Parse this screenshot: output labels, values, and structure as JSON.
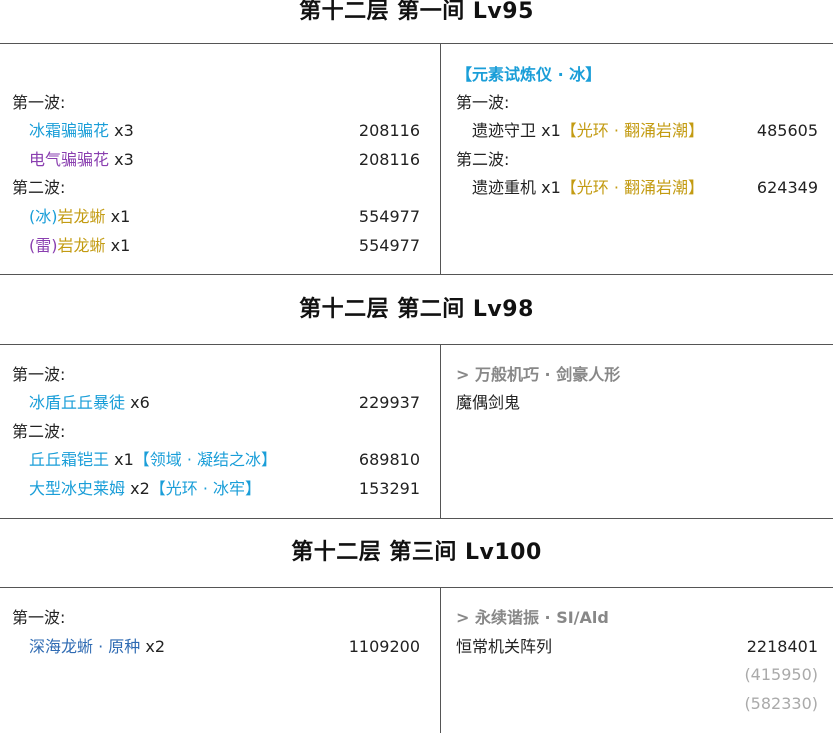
{
  "colors": {
    "ice": "#1a9ed8",
    "electro": "#8a3fb0",
    "geo": "#c39b12",
    "hydro": "#2f6bb3",
    "muted": "#888888",
    "line": "#555555"
  },
  "chambers": [
    {
      "title": "第十二层  第一间 Lv95",
      "left": {
        "wave1_label": "第一波:",
        "wave1": [
          {
            "name": "冰霜骗骗花",
            "count": "x3",
            "hp": "208116"
          },
          {
            "name": "电气骗骗花",
            "count": "x3",
            "hp": "208116"
          }
        ],
        "wave2_label": "第二波:",
        "wave2": [
          {
            "prefix": "(冰)",
            "name": "岩龙蜥",
            "count": "x1",
            "hp": "554977"
          },
          {
            "prefix": "(雷)",
            "name": "岩龙蜥",
            "count": "x1",
            "hp": "554977"
          }
        ]
      },
      "right": {
        "header": "【元素试炼仪 · 冰】",
        "wave1_label": "第一波:",
        "wave1": [
          {
            "name": "遗迹守卫",
            "count": "x1",
            "tag": "【光环 · 翻涌岩潮】",
            "hp": "485605"
          }
        ],
        "wave2_label": "第二波:",
        "wave2": [
          {
            "name": "遗迹重机",
            "count": "x1",
            "tag": "【光环 · 翻涌岩潮】",
            "hp": "624349"
          }
        ]
      }
    },
    {
      "title": "第十二层  第二间 Lv98",
      "left": {
        "wave1_label": "第一波:",
        "wave1": [
          {
            "name": "冰盾丘丘暴徒",
            "count": "x6",
            "hp": "229937"
          }
        ],
        "wave2_label": "第二波:",
        "wave2": [
          {
            "name": "丘丘霜铠王",
            "count": "x1",
            "tag": "【领域 · 凝结之冰】",
            "hp": "689810"
          },
          {
            "name": "大型冰史莱姆",
            "count": "x2",
            "tag": "【光环 · 冰牢】",
            "hp": "153291"
          }
        ]
      },
      "right": {
        "header": ">  万般机巧 · 剑豪人形",
        "enemy": "魔偶剑鬼"
      }
    },
    {
      "title": "第十二层  第三间 Lv100",
      "left": {
        "wave1_label": "第一波:",
        "wave1": [
          {
            "name": "深海龙蜥 · 原种",
            "count": "x2",
            "hp": "1109200"
          }
        ]
      },
      "right": {
        "header": ">  永续谐振 · SI/Ald",
        "enemy": "恒常机关阵列",
        "hp": "2218401",
        "sub_hp": [
          "(415950)",
          "(582330)"
        ]
      }
    }
  ]
}
